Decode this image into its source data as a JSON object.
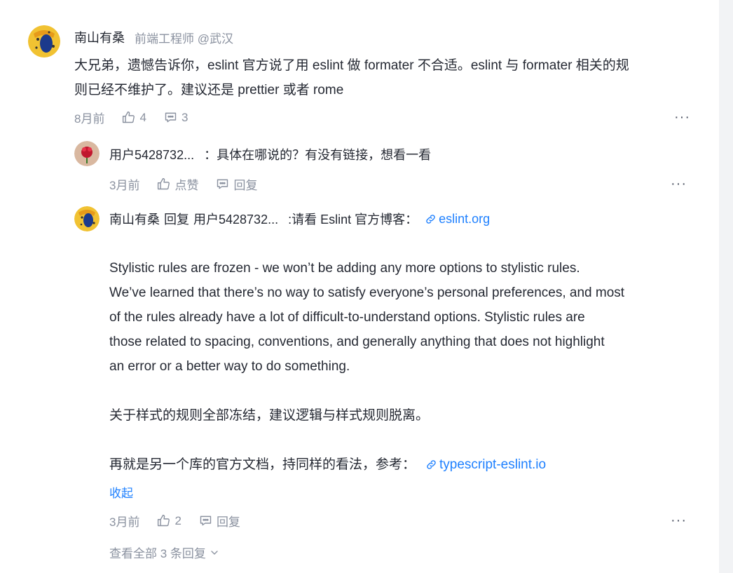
{
  "main_comment": {
    "username": "南山有桑",
    "title": "前端工程师 @武汉",
    "text_line1": "大兄弟，遗憾告诉你，eslint 官方说了用 eslint 做 formater 不合适。eslint 与 formater 相关的规",
    "text_line2": "则已经不维护了。建议还是 prettier 或者 rome",
    "time": "8月前",
    "likes": "4",
    "comments": "3",
    "more": "···"
  },
  "reply1": {
    "username": "用户5428732...",
    "text": "：具体在哪说的？有没有链接，想看一看",
    "time": "3月前",
    "like_label": "点赞",
    "reply_label": "回复",
    "more": "···"
  },
  "reply2": {
    "username": "南山有桑",
    "reply_word": "回复",
    "target_user": "用户5428732...",
    "text": ":请看 Eslint 官方博客：",
    "link1": "eslint.org",
    "para1_l1": "Stylistic rules are frozen - we won’t be adding any more options to stylistic rules.",
    "para1_l2": "We’ve learned that there’s no way to satisfy everyone’s personal preferences, and most",
    "para1_l3": "of the rules already have a lot of difficult-to-understand options. Stylistic rules are",
    "para1_l4": "those related to spacing, conventions, and generally anything that does not highlight",
    "para1_l5": "an error or a better way to do something.",
    "para2": "关于样式的规则全部冻结，建议逻辑与样式规则脱离。",
    "para3": "再就是另一个库的官方文档，持同样的看法，参考：",
    "link2": "typescript-eslint.io",
    "collapse": "收起",
    "time": "3月前",
    "likes": "2",
    "reply_label": "回复",
    "more": "···"
  },
  "view_all": "查看全部 3 条回复",
  "icons": {
    "like": "thumbs-up-icon",
    "comment": "comment-icon",
    "link": "link-icon",
    "chevron": "chevron-down-icon"
  },
  "colors": {
    "text": "#252933",
    "muted": "#8a919f",
    "link": "#1e80ff"
  }
}
